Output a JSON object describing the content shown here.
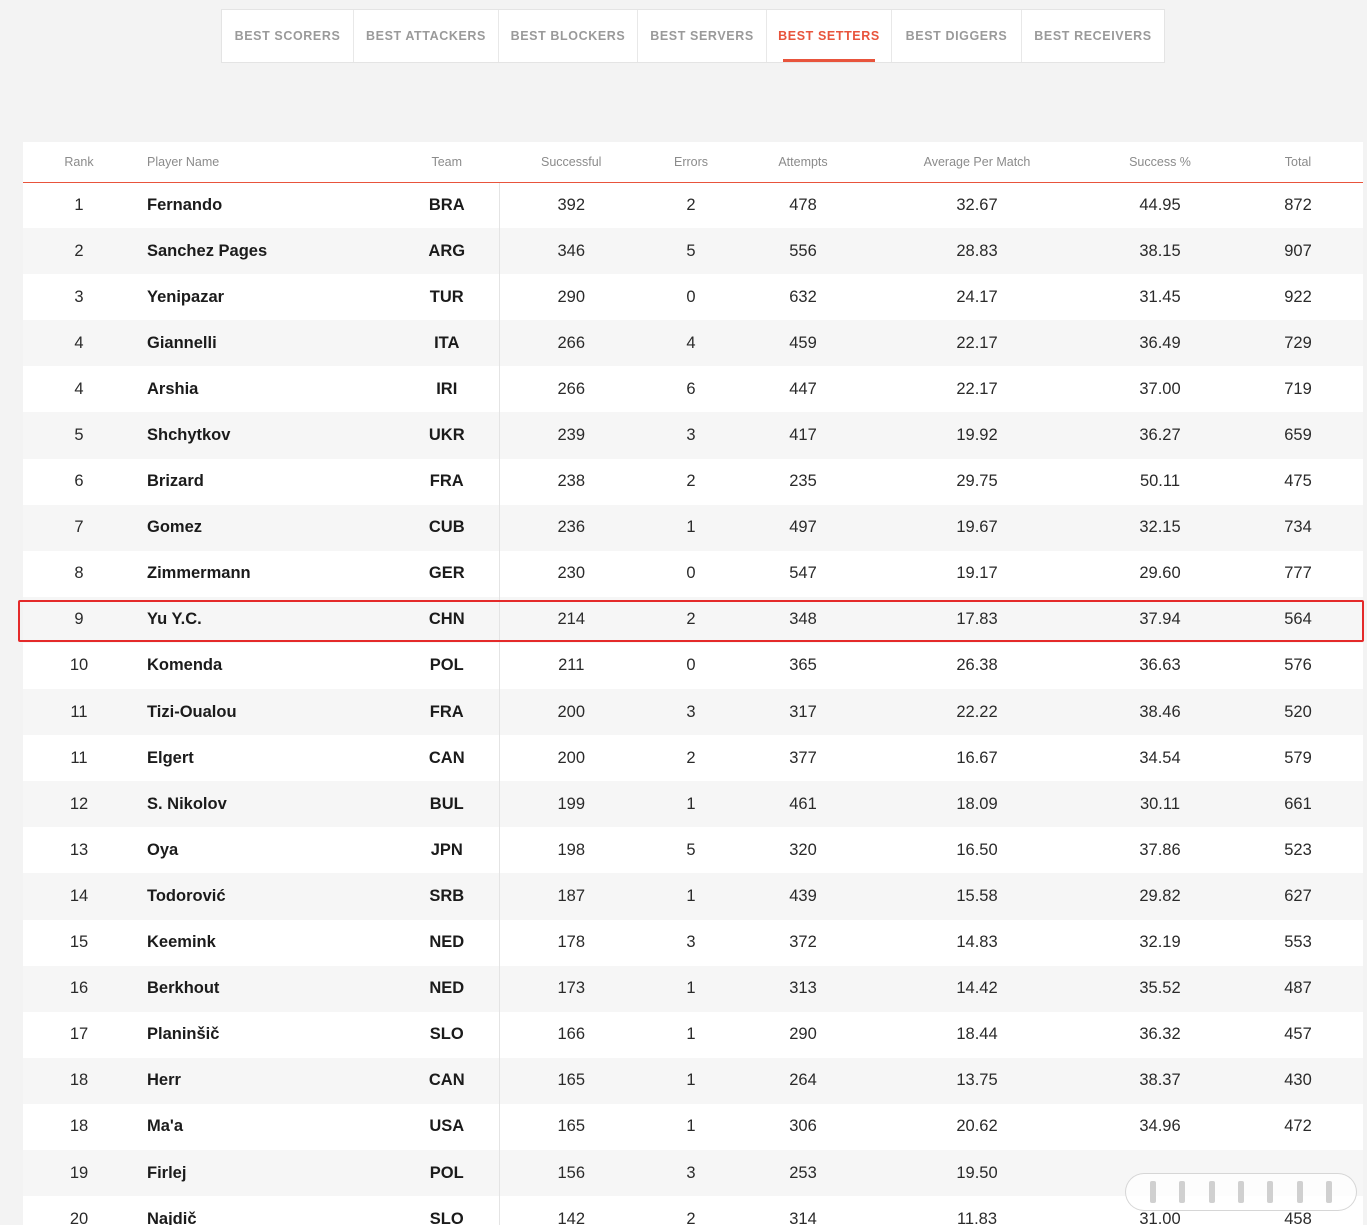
{
  "tabs": [
    {
      "label": "BEST SCORERS",
      "active": false
    },
    {
      "label": "BEST ATTACKERS",
      "active": false
    },
    {
      "label": "BEST BLOCKERS",
      "active": false
    },
    {
      "label": "BEST SERVERS",
      "active": false
    },
    {
      "label": "BEST SETTERS",
      "active": true
    },
    {
      "label": "BEST DIGGERS",
      "active": false
    },
    {
      "label": "BEST RECEIVERS",
      "active": false
    }
  ],
  "accent_color": "#e8543c",
  "highlight_color": "#e42a2a",
  "table": {
    "headers": [
      "Rank",
      "Player Name",
      "Team",
      "Successful",
      "Errors",
      "Attempts",
      "Average Per Match",
      "Success %",
      "Total"
    ],
    "highlighted_rank_index": 9,
    "rows": [
      [
        "1",
        "Fernando",
        "BRA",
        "392",
        "2",
        "478",
        "32.67",
        "44.95",
        "872"
      ],
      [
        "2",
        "Sanchez Pages",
        "ARG",
        "346",
        "5",
        "556",
        "28.83",
        "38.15",
        "907"
      ],
      [
        "3",
        "Yenipazar",
        "TUR",
        "290",
        "0",
        "632",
        "24.17",
        "31.45",
        "922"
      ],
      [
        "4",
        "Giannelli",
        "ITA",
        "266",
        "4",
        "459",
        "22.17",
        "36.49",
        "729"
      ],
      [
        "4",
        "Arshia",
        "IRI",
        "266",
        "6",
        "447",
        "22.17",
        "37.00",
        "719"
      ],
      [
        "5",
        "Shchytkov",
        "UKR",
        "239",
        "3",
        "417",
        "19.92",
        "36.27",
        "659"
      ],
      [
        "6",
        "Brizard",
        "FRA",
        "238",
        "2",
        "235",
        "29.75",
        "50.11",
        "475"
      ],
      [
        "7",
        "Gomez",
        "CUB",
        "236",
        "1",
        "497",
        "19.67",
        "32.15",
        "734"
      ],
      [
        "8",
        "Zimmermann",
        "GER",
        "230",
        "0",
        "547",
        "19.17",
        "29.60",
        "777"
      ],
      [
        "9",
        "Yu Y.C.",
        "CHN",
        "214",
        "2",
        "348",
        "17.83",
        "37.94",
        "564"
      ],
      [
        "10",
        "Komenda",
        "POL",
        "211",
        "0",
        "365",
        "26.38",
        "36.63",
        "576"
      ],
      [
        "11",
        "Tizi-Oualou",
        "FRA",
        "200",
        "3",
        "317",
        "22.22",
        "38.46",
        "520"
      ],
      [
        "11",
        "Elgert",
        "CAN",
        "200",
        "2",
        "377",
        "16.67",
        "34.54",
        "579"
      ],
      [
        "12",
        "S. Nikolov",
        "BUL",
        "199",
        "1",
        "461",
        "18.09",
        "30.11",
        "661"
      ],
      [
        "13",
        "Oya",
        "JPN",
        "198",
        "5",
        "320",
        "16.50",
        "37.86",
        "523"
      ],
      [
        "14",
        "Todorović",
        "SRB",
        "187",
        "1",
        "439",
        "15.58",
        "29.82",
        "627"
      ],
      [
        "15",
        "Keemink",
        "NED",
        "178",
        "3",
        "372",
        "14.83",
        "32.19",
        "553"
      ],
      [
        "16",
        "Berkhout",
        "NED",
        "173",
        "1",
        "313",
        "14.42",
        "35.52",
        "487"
      ],
      [
        "17",
        "Planinšič",
        "SLO",
        "166",
        "1",
        "290",
        "18.44",
        "36.32",
        "457"
      ],
      [
        "18",
        "Herr",
        "CAN",
        "165",
        "1",
        "264",
        "13.75",
        "38.37",
        "430"
      ],
      [
        "18",
        "Ma'a",
        "USA",
        "165",
        "1",
        "306",
        "20.62",
        "34.96",
        "472"
      ],
      [
        "19",
        "Firlej",
        "POL",
        "156",
        "3",
        "253",
        "19.50",
        "",
        ""
      ],
      [
        "20",
        "Najdič",
        "SLO",
        "142",
        "2",
        "314",
        "11.83",
        "31.00",
        "458"
      ]
    ]
  }
}
